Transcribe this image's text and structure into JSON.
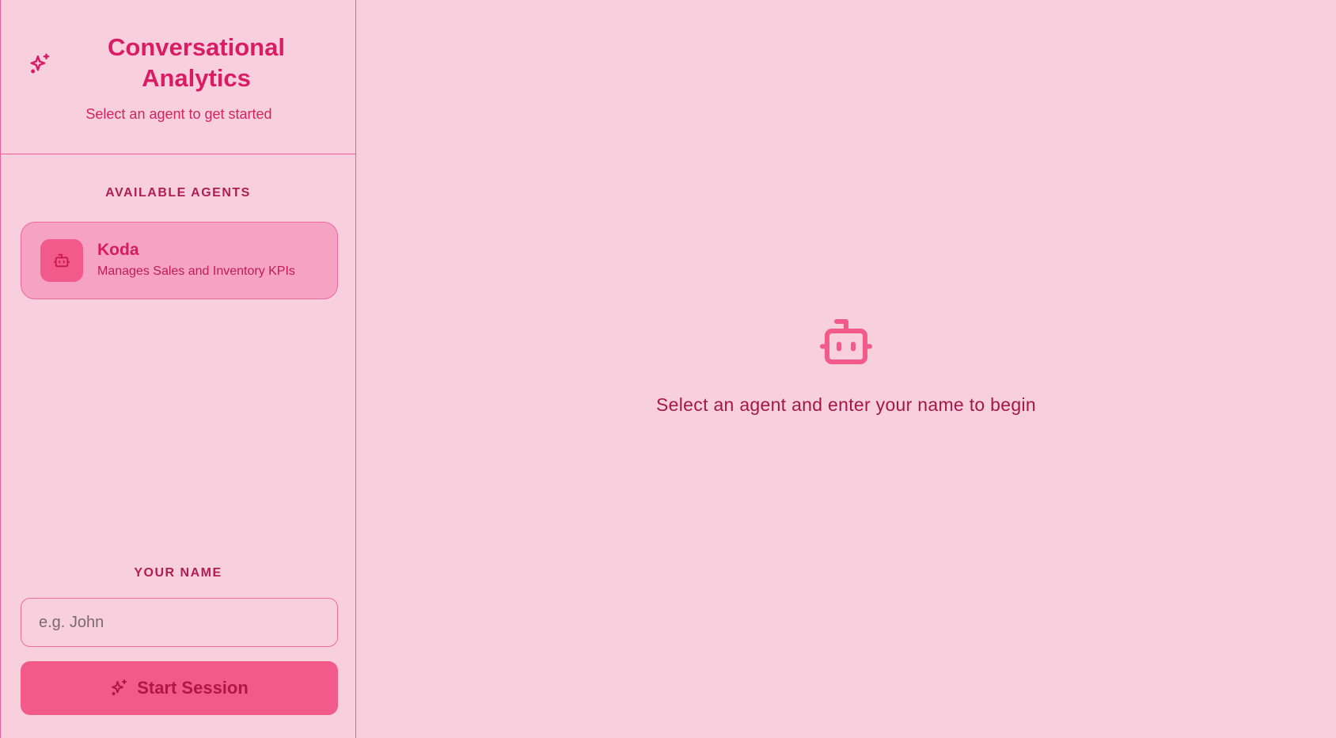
{
  "brand": {
    "title": "Conversational Analytics",
    "subtitle": "Select an agent to get started",
    "icon": "sparkles-icon"
  },
  "agents_section": {
    "label": "AVAILABLE AGENTS",
    "agents": [
      {
        "name": "Koda",
        "description": "Manages Sales and Inventory KPIs",
        "icon": "bot-icon",
        "selected": true
      }
    ]
  },
  "name_section": {
    "label": "YOUR NAME",
    "input_value": "",
    "input_placeholder": "e.g. John"
  },
  "start_button": {
    "label": "Start Session",
    "icon": "sparkles-icon"
  },
  "main": {
    "empty_icon": "bot-icon",
    "empty_message": "Select an agent and enter your name to begin"
  },
  "colors": {
    "background": "#f8cfdd",
    "accent": "#f25a8c",
    "accent_text": "#da1d63",
    "border": "#ef5f96",
    "card_selected": "#f5a2c3"
  }
}
